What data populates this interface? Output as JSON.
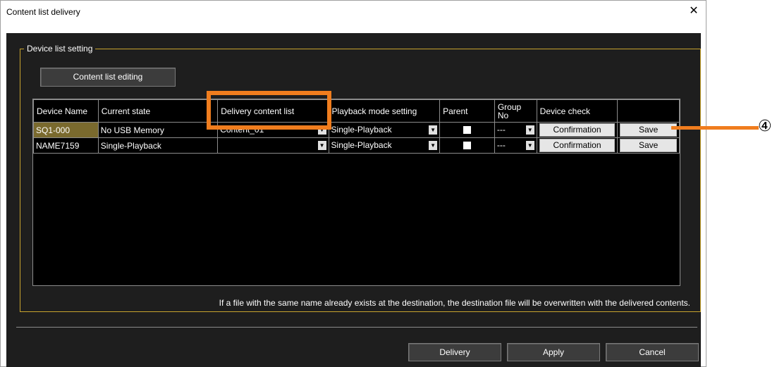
{
  "window": {
    "title": "Content list delivery",
    "close_glyph": "✕"
  },
  "group": {
    "label": "Device list setting"
  },
  "buttons": {
    "content_list_editing": "Content list editing",
    "delivery": "Delivery",
    "apply": "Apply",
    "cancel": "Cancel"
  },
  "table": {
    "headers": {
      "device_name": "Device Name",
      "current_state": "Current state",
      "delivery_content_list": "Delivery content list",
      "playback_mode": "Playback mode setting",
      "parent": "Parent",
      "group_no": "Group No",
      "device_check": "Device check"
    },
    "rows": [
      {
        "device_name": "SQ1-000",
        "current_state": "No USB Memory",
        "delivery_content_list": "Content_01",
        "playback_mode": "Single-Playback",
        "group_no": "---",
        "confirmation": "Confirmation",
        "save": "Save"
      },
      {
        "device_name": "NAME7159",
        "current_state": "Single-Playback",
        "delivery_content_list": "",
        "playback_mode": "Single-Playback",
        "group_no": "---",
        "confirmation": "Confirmation",
        "save": "Save"
      }
    ]
  },
  "note": "If a file with the same name already exists at the destination, the destination file will be overwritten with the delivered contents.",
  "annotation": {
    "marker": "④",
    "color": "#f07d1e"
  }
}
